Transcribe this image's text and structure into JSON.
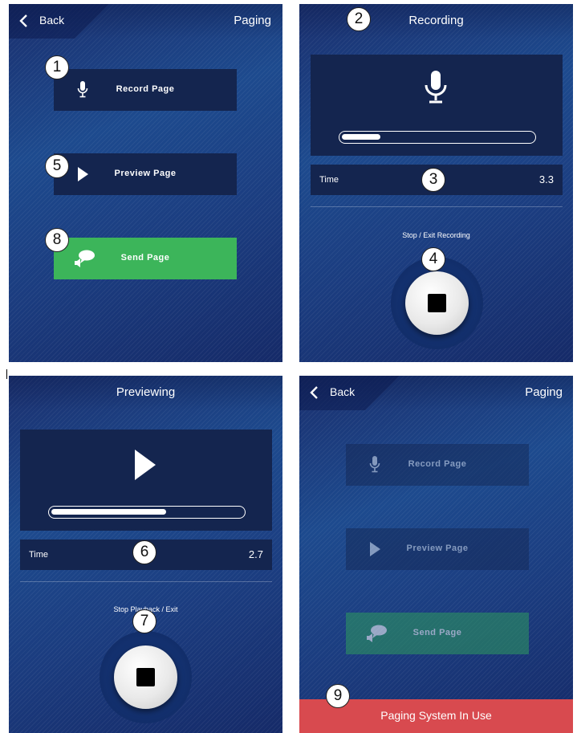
{
  "screen1": {
    "back_label": "Back",
    "title": "Paging",
    "buttons": {
      "record": {
        "label": "Record Page",
        "icon": "microphone-icon"
      },
      "preview": {
        "label": "Preview Page",
        "icon": "play-icon"
      },
      "send": {
        "label": "Send Page",
        "icon": "speech-bubble-speaker-icon"
      }
    },
    "badges": {
      "record": "1",
      "preview": "5",
      "send": "8"
    }
  },
  "screen2": {
    "title": "Recording",
    "icon": "microphone-icon",
    "progress": 0.2,
    "time_label": "Time",
    "time_value": "3.3",
    "hint": "Stop / Exit Recording",
    "stop_icon": "stop-icon",
    "badges": {
      "title": "2",
      "time": "3",
      "stop": "4"
    }
  },
  "screen3": {
    "title": "Previewing",
    "icon": "play-icon",
    "progress": 0.6,
    "time_label": "Time",
    "time_value": "2.7",
    "hint": "Stop Playback / Exit",
    "stop_icon": "stop-icon",
    "badges": {
      "time": "6",
      "stop": "7"
    }
  },
  "screen4": {
    "back_label": "Back",
    "title": "Paging",
    "buttons": {
      "record": {
        "label": "Record Page"
      },
      "preview": {
        "label": "Preview Page"
      },
      "send": {
        "label": "Send Page"
      }
    },
    "alert": "Paging System In Use",
    "badges": {
      "alert": "9"
    }
  },
  "colors": {
    "background_blue": "#1d4a8e",
    "button_navy": "#14254f",
    "send_green": "#3cb55a",
    "alert_red": "#d84a4f",
    "text": "#ffffff"
  }
}
